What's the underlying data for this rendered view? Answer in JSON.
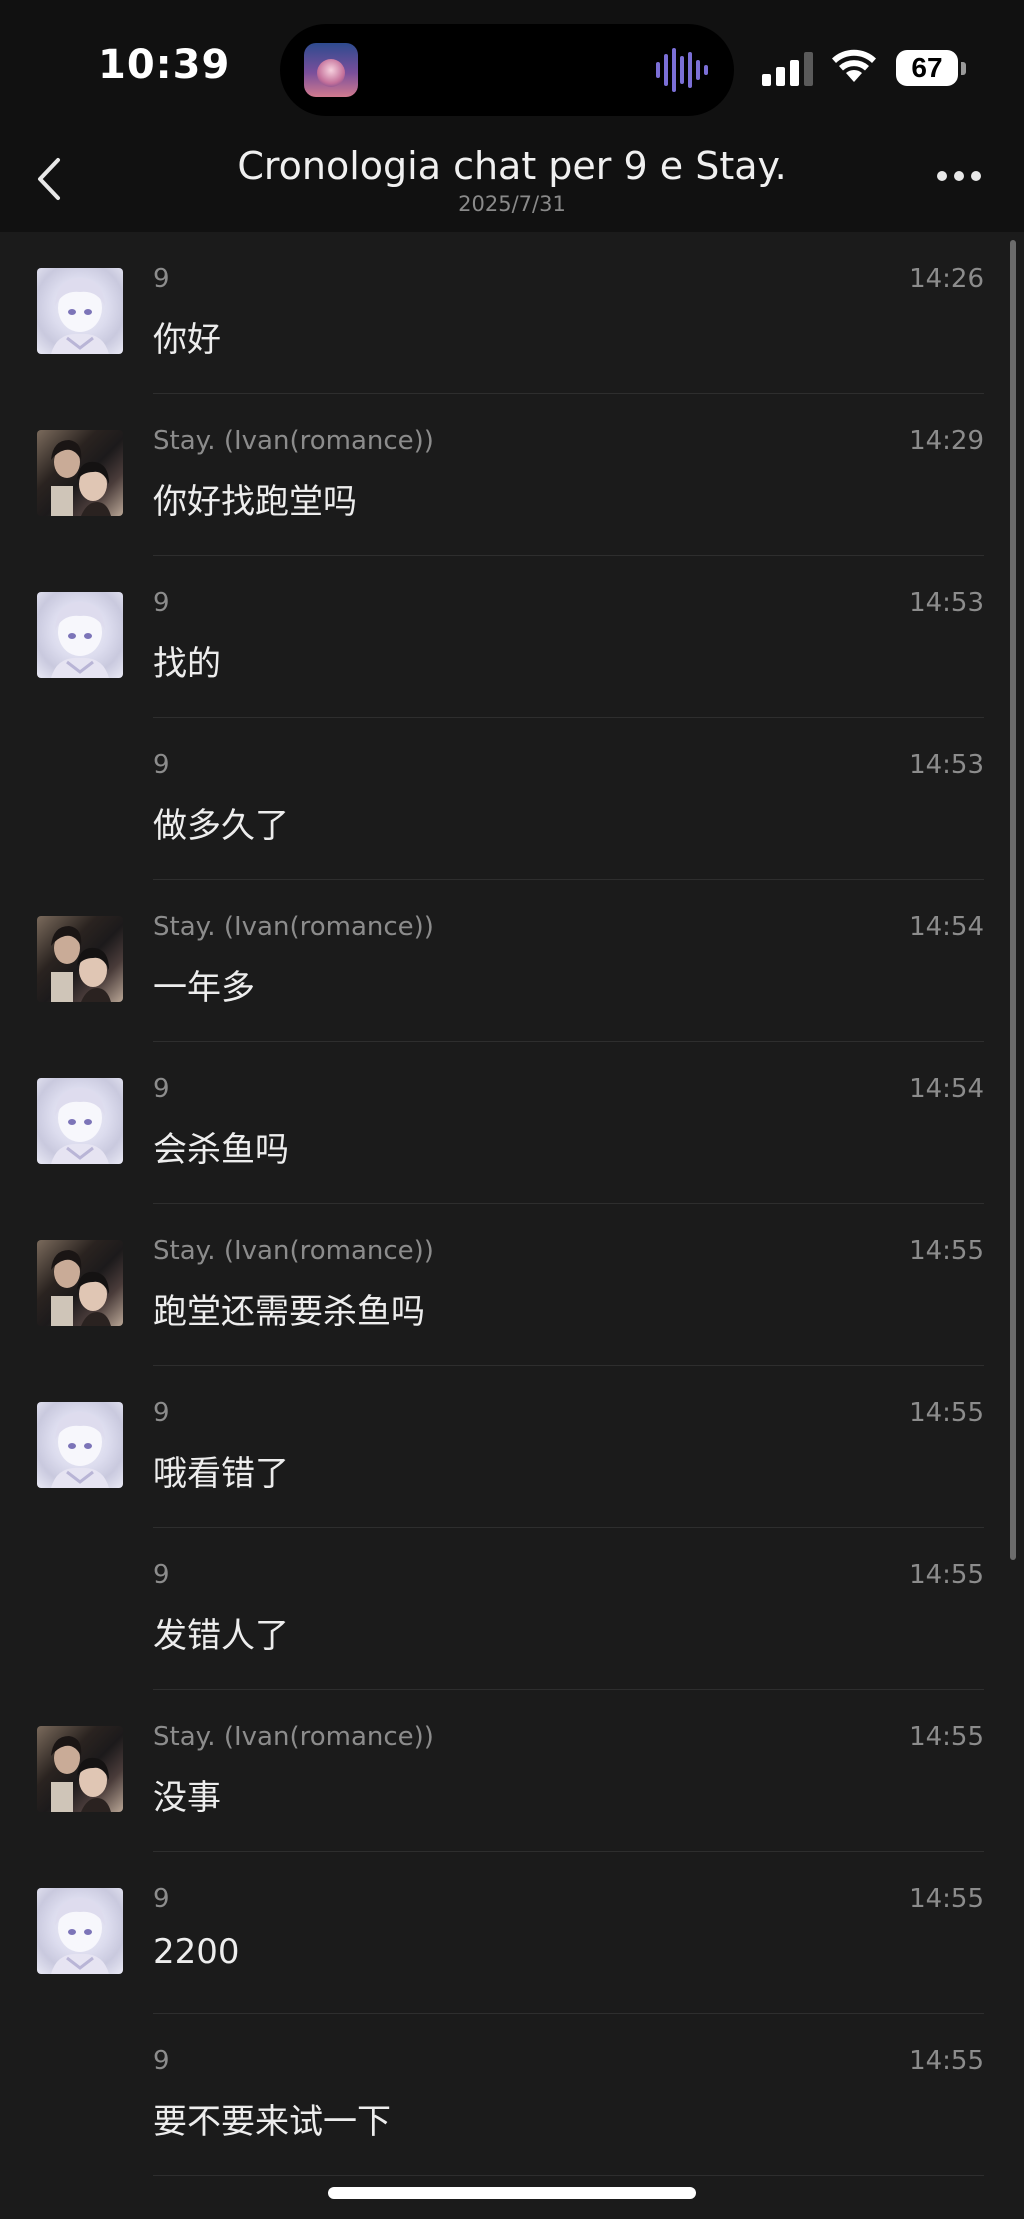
{
  "status_bar": {
    "time": "10:39",
    "battery": "67",
    "app_icon": "podcast-app-icon",
    "waveform_color": "#7b6fd6"
  },
  "header": {
    "title": "Cronologia chat per 9 e Stay.",
    "date": "2025/7/31"
  },
  "messages": [
    {
      "sender": "9",
      "time": "14:26",
      "text": "你好",
      "avatar": "avatar-9"
    },
    {
      "sender": "Stay. (Ivan(romance))",
      "time": "14:29",
      "text": "你好找跑堂吗",
      "avatar": "avatar-stay"
    },
    {
      "sender": "9",
      "time": "14:53",
      "text": "找的",
      "avatar": "avatar-9"
    },
    {
      "sender": "9",
      "time": "14:53",
      "text": "做多久了",
      "avatar": ""
    },
    {
      "sender": "Stay. (Ivan(romance))",
      "time": "14:54",
      "text": "一年多",
      "avatar": "avatar-stay"
    },
    {
      "sender": "9",
      "time": "14:54",
      "text": "会杀鱼吗",
      "avatar": "avatar-9"
    },
    {
      "sender": "Stay. (Ivan(romance))",
      "time": "14:55",
      "text": "跑堂还需要杀鱼吗",
      "avatar": "avatar-stay"
    },
    {
      "sender": "9",
      "time": "14:55",
      "text": "哦看错了",
      "avatar": "avatar-9"
    },
    {
      "sender": "9",
      "time": "14:55",
      "text": "发错人了",
      "avatar": ""
    },
    {
      "sender": "Stay. (Ivan(romance))",
      "time": "14:55",
      "text": "没事",
      "avatar": "avatar-stay"
    },
    {
      "sender": "9",
      "time": "14:55",
      "text": "2200",
      "avatar": "avatar-9"
    },
    {
      "sender": "9",
      "time": "14:55",
      "text": "要不要来试一下",
      "avatar": ""
    }
  ]
}
